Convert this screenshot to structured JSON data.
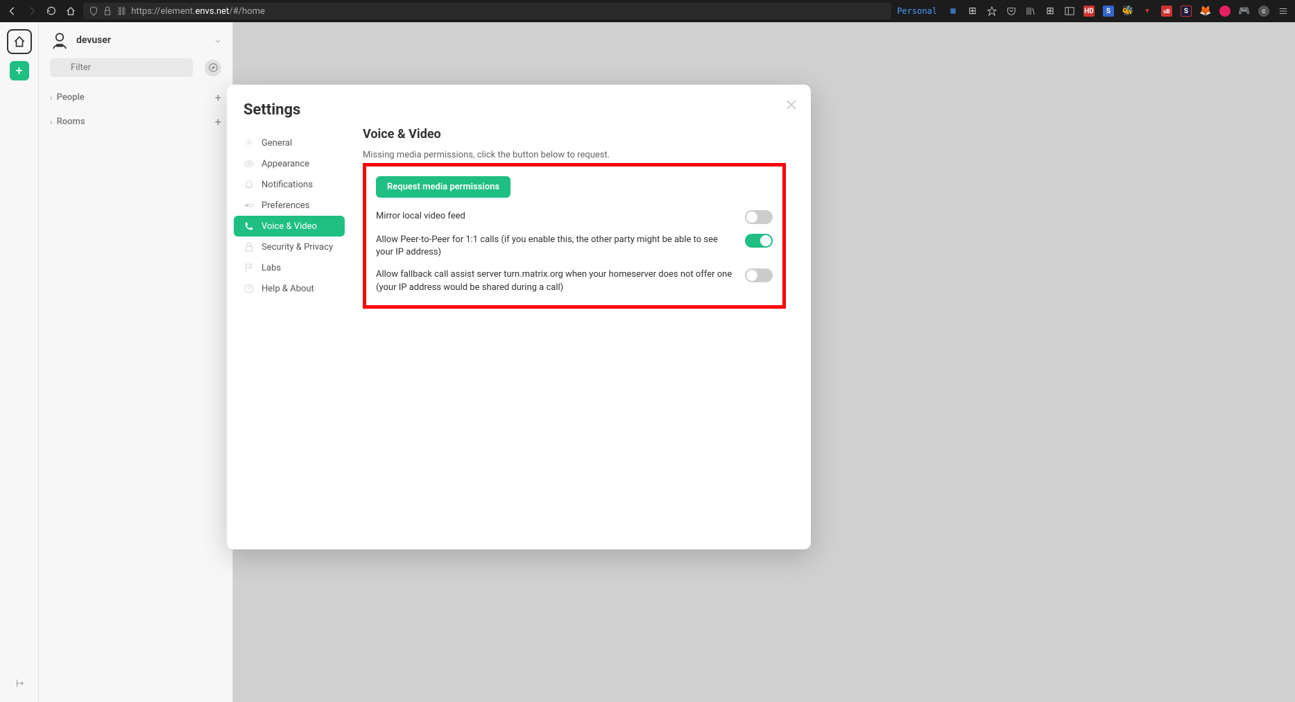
{
  "browser": {
    "url_prefix": "https://element.",
    "url_domain": "envs.net",
    "url_path": "/#/home",
    "personal_label": "Personal"
  },
  "sidebar": {
    "user_name": "devuser",
    "filter_placeholder": "Filter",
    "sections": [
      {
        "label": "People"
      },
      {
        "label": "Rooms"
      }
    ]
  },
  "modal": {
    "title": "Settings",
    "nav_items": [
      {
        "label": "General",
        "icon": "gear"
      },
      {
        "label": "Appearance",
        "icon": "eye"
      },
      {
        "label": "Notifications",
        "icon": "bell"
      },
      {
        "label": "Preferences",
        "icon": "slider"
      },
      {
        "label": "Voice & Video",
        "icon": "phone"
      },
      {
        "label": "Security & Privacy",
        "icon": "lock"
      },
      {
        "label": "Labs",
        "icon": "flag"
      },
      {
        "label": "Help & About",
        "icon": "question"
      }
    ],
    "content": {
      "title": "Voice & Video",
      "permission_text": "Missing media permissions, click the button below to request.",
      "request_button": "Request media permissions",
      "toggles": [
        {
          "label": "Mirror local video feed",
          "on": false
        },
        {
          "label": "Allow Peer-to-Peer for 1:1 calls (if you enable this, the other party might be able to see your IP address)",
          "on": true
        },
        {
          "label": "Allow fallback call assist server turn.matrix.org when your homeserver does not offer one (your IP address would be shared during a call)",
          "on": false
        }
      ]
    }
  }
}
